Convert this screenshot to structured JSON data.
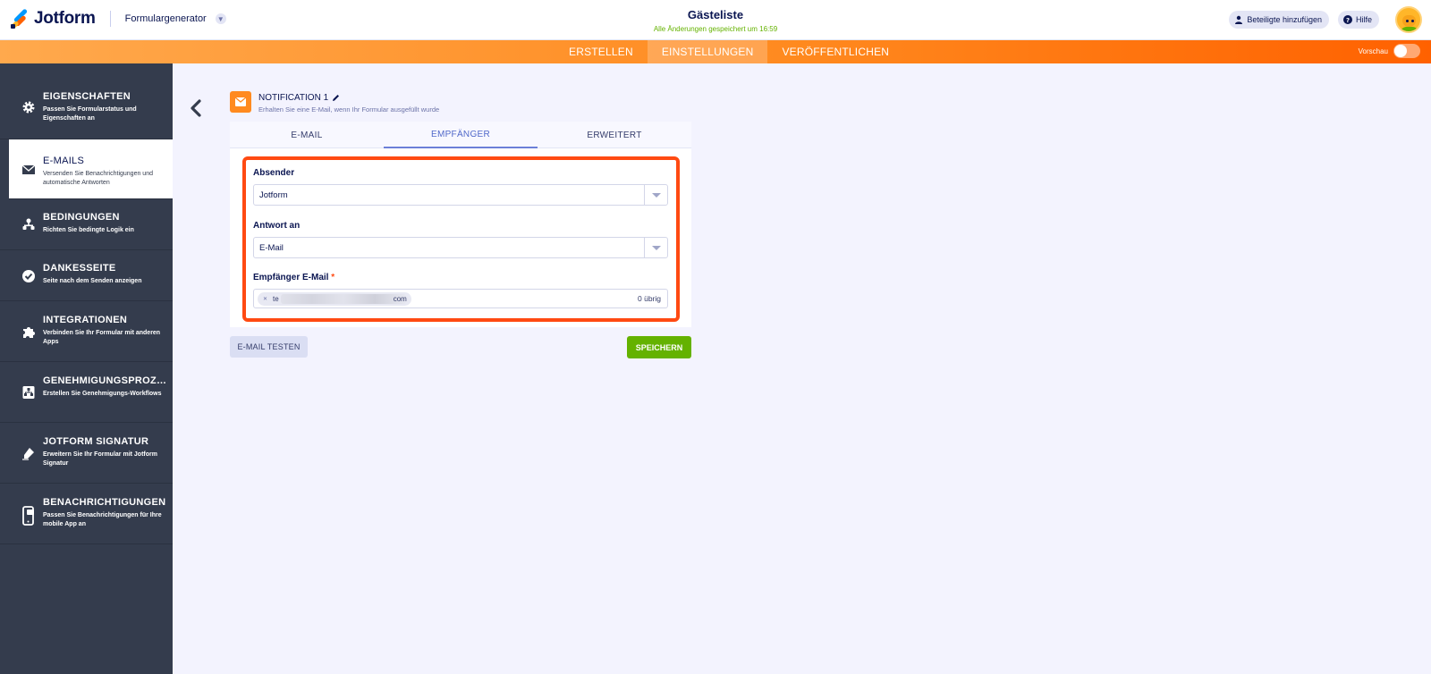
{
  "header": {
    "logo_text": "Jotform",
    "builder_label": "Formulargenerator",
    "form_title": "Gästeliste",
    "save_status": "Alle Änderungen gespeichert um 16:59",
    "add_participants_label": "Beteiligte hinzufügen",
    "help_label": "Hilfe"
  },
  "nav": {
    "tabs": [
      {
        "label": "ERSTELLEN"
      },
      {
        "label": "EINSTELLUNGEN"
      },
      {
        "label": "VERÖFFENTLICHEN"
      }
    ],
    "preview_label": "Vorschau"
  },
  "sidebar": {
    "items": [
      {
        "title": "EIGENSCHAFTEN",
        "desc": "Passen Sie Formularstatus und Eigenschaften an",
        "icon": "gear-icon"
      },
      {
        "title": "E-MAILS",
        "desc": "Versenden Sie Benachrichtigungen und automatische Antworten",
        "icon": "envelope-icon"
      },
      {
        "title": "BEDINGUNGEN",
        "desc": "Richten Sie bedingte Logik ein",
        "icon": "hierarchy-icon"
      },
      {
        "title": "DANKESSEITE",
        "desc": "Seite nach dem Senden anzeigen",
        "icon": "check-circle-icon"
      },
      {
        "title": "INTEGRATIONEN",
        "desc": "Verbinden Sie Ihr Formular mit anderen Apps",
        "icon": "puzzle-icon"
      },
      {
        "title": "GENEHMIGUNGSPROZES...",
        "desc": "Erstellen Sie Genehmigungs-Workflows",
        "icon": "approval-icon"
      },
      {
        "title": "JOTFORM SIGNATUR",
        "desc": "Erweitern Sie Ihr Formular mit Jotform Signatur",
        "icon": "signature-pen-icon"
      },
      {
        "title": "BENACHRICHTIGUNGEN",
        "desc": "Passen Sie Benachrichtigungen für Ihre mobile App an",
        "icon": "mobile-icon"
      }
    ]
  },
  "notification": {
    "title": "NOTIFICATION 1",
    "subtitle": "Erhalten Sie eine E-Mail, wenn Ihr Formular ausgefüllt wurde"
  },
  "tabs": [
    {
      "label": "E-MAIL"
    },
    {
      "label": "EMPFÄNGER"
    },
    {
      "label": "ERWEITERT"
    }
  ],
  "fields": {
    "sender_label": "Absender",
    "sender_value": "Jotform",
    "reply_to_label": "Antwort an",
    "reply_to_value": "E-Mail",
    "recipient_label": "Empfänger E-Mail",
    "recipient_required": "*",
    "recipient_chip_start": "te",
    "recipient_chip_end": "com",
    "recipient_remaining": "0 übrig"
  },
  "actions": {
    "test_label": "E-MAIL TESTEN",
    "save_label": "SPEICHERN"
  },
  "colors": {
    "accent_orange": "#ff6100",
    "highlight": "#ff4a12",
    "save_green": "#64b200",
    "sidebar_bg": "#343c4d"
  }
}
